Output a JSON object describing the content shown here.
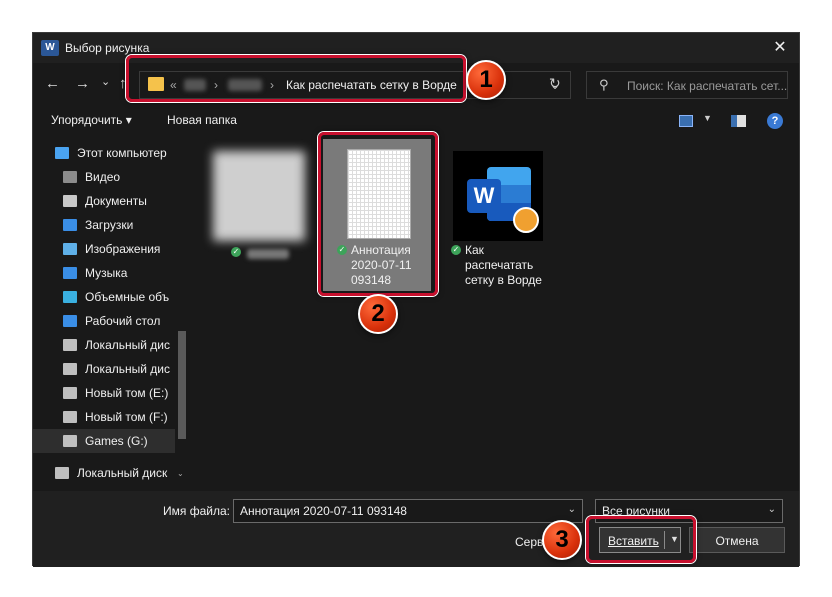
{
  "window": {
    "title": "Выбор рисунка",
    "app_logo": "W",
    "close_glyph": "✕"
  },
  "nav": {
    "back_icon": "←",
    "forward_icon": "→",
    "recent_icon": "⌄",
    "up_icon": "↑",
    "address_prefix": "«",
    "current_folder": "Как распечатать сетку в Ворде",
    "dropdown_icon": "⌄",
    "refresh_icon": "↻",
    "search_placeholder": "Поиск: Как распечатать сет..."
  },
  "toolbar": {
    "organize_label": "Упорядочить ▾",
    "new_folder_label": "Новая папка",
    "help_label": "?"
  },
  "sidebar": {
    "items": [
      {
        "label": "Этот компьютер",
        "icon": "computer-icon",
        "color": "#4aa3f0"
      },
      {
        "label": "Видео",
        "icon": "video-icon",
        "color": "#8c8c8c"
      },
      {
        "label": "Документы",
        "icon": "documents-icon",
        "color": "#c8c8c8"
      },
      {
        "label": "Загрузки",
        "icon": "downloads-icon",
        "color": "#3a8ee6"
      },
      {
        "label": "Изображения",
        "icon": "images-icon",
        "color": "#5fb0e8"
      },
      {
        "label": "Музыка",
        "icon": "music-icon",
        "color": "#3a8ee6"
      },
      {
        "label": "Объемные объ",
        "icon": "3d-objects-icon",
        "color": "#3ab0e0"
      },
      {
        "label": "Рабочий стол",
        "icon": "desktop-icon",
        "color": "#3a8ee6"
      },
      {
        "label": "Локальный дис",
        "icon": "drive-icon",
        "color": "#bfbfbf"
      },
      {
        "label": "Локальный дис",
        "icon": "drive-icon",
        "color": "#bfbfbf"
      },
      {
        "label": "Новый том (E:)",
        "icon": "drive-icon",
        "color": "#bfbfbf"
      },
      {
        "label": "Новый том (F:)",
        "icon": "drive-icon",
        "color": "#bfbfbf"
      },
      {
        "label": "Games (G:)",
        "icon": "drive-icon",
        "color": "#bfbfbf"
      },
      {
        "label": "Локальный диск",
        "icon": "drive-icon",
        "color": "#bfbfbf"
      }
    ],
    "chevron": "⌄"
  },
  "files": [
    {
      "name_lines": [
        "",
        "",
        ""
      ],
      "selected": false
    },
    {
      "name_lines": [
        "Аннотация",
        "2020-07-11",
        "093148"
      ],
      "selected": true
    },
    {
      "name_lines": [
        "Как",
        "распечатать",
        "сетку в Ворде"
      ],
      "selected": false
    }
  ],
  "bottom": {
    "filename_label": "Имя файла:",
    "filename_value": "Аннотация 2020-07-11 093148",
    "filetype_value": "Все рисунки",
    "service_label": "Серв",
    "insert_label": "Вставить",
    "cancel_label": "Отмена"
  },
  "callouts": {
    "step1": "1",
    "step2": "2",
    "step3": "3",
    "color": "#c8102e"
  }
}
